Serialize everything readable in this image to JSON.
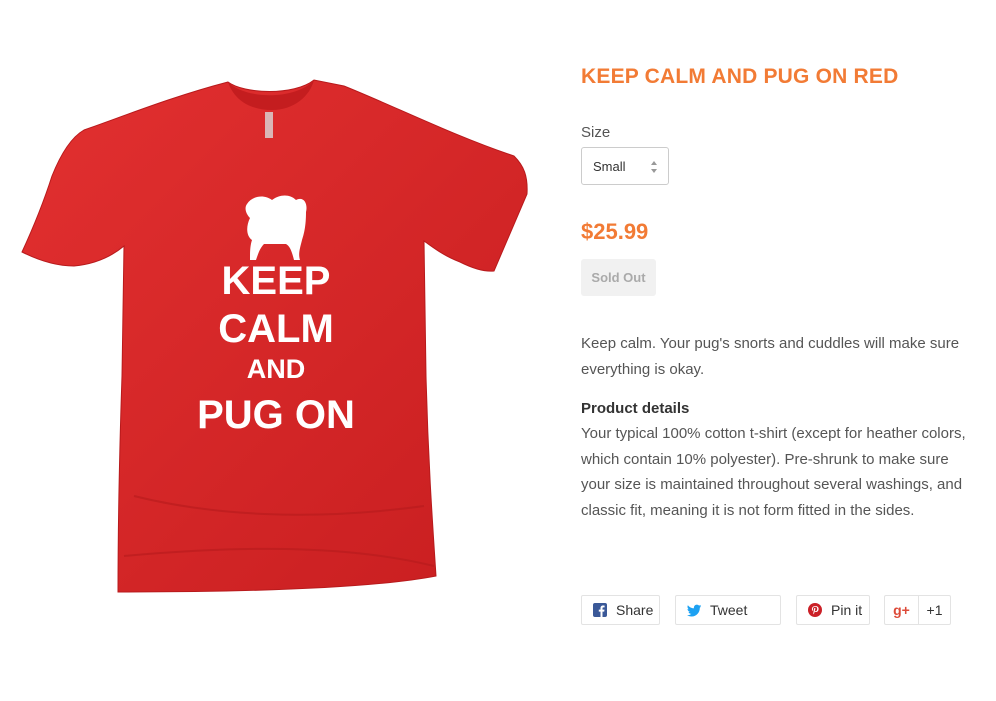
{
  "product": {
    "title": "KEEP CALM AND PUG ON RED",
    "image": {
      "alt": "red t-shirt",
      "print_lines": [
        "KEEP",
        "CALM",
        "AND",
        "PUG ON"
      ],
      "shirt_color": "#e0282a",
      "print_color": "#ffffff",
      "icon": "pug-silhouette-icon"
    },
    "size_label": "Size",
    "size_selected": "Small",
    "price": "$25.99",
    "sold_out_label": "Sold Out",
    "description": "Keep calm. Your pug's snorts and cuddles will make sure everything is okay.",
    "details_title": "Product details",
    "details_text": "Your typical 100% cotton t-shirt (except for heather colors, which contain 10% polyester). Pre-shrunk to make sure your size is maintained throughout several washings, and classic fit, meaning it is not form fitted in the sides."
  },
  "social": {
    "share_label": "Share",
    "tweet_label": "Tweet",
    "pin_label": "Pin it",
    "gplus_icon": "g+",
    "gplus_count": "+1"
  },
  "colors": {
    "accent": "#f27b35",
    "facebook": "#3b5998",
    "twitter": "#1da1f2",
    "pinterest": "#cb2027",
    "google_plus": "#dd4b39"
  }
}
